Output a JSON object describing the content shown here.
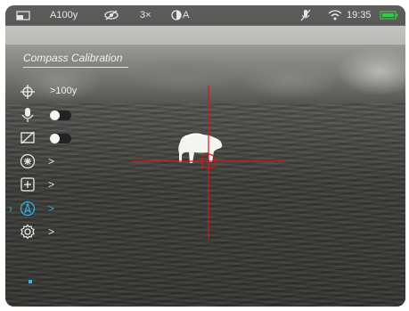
{
  "status_bar": {
    "screen_icon": "screen-mode-icon",
    "profile": "A100y",
    "eye_icon": "eye-off-icon",
    "zoom": "3×",
    "palette_mode": "A",
    "mic_icon": "mic-off-icon",
    "wifi_icon": "wifi-icon",
    "time": "19:35",
    "battery_color": "#2ecc40"
  },
  "menu": {
    "title": "Compass Calibration",
    "items": [
      {
        "icon": "crosshair-icon",
        "value": ">100y"
      },
      {
        "icon": "microphone-icon",
        "toggle": "off"
      },
      {
        "icon": "display-off-icon",
        "toggle": "off"
      },
      {
        "icon": "brightness-icon",
        "value": ">"
      },
      {
        "icon": "add-box-icon",
        "value": ">"
      },
      {
        "icon": "compass-icon",
        "value": ">",
        "selected": true
      },
      {
        "icon": "settings-gear-icon",
        "value": ">"
      }
    ],
    "accent_color": "#2fb0e6"
  },
  "reticle": {
    "color": "#d8141a"
  }
}
